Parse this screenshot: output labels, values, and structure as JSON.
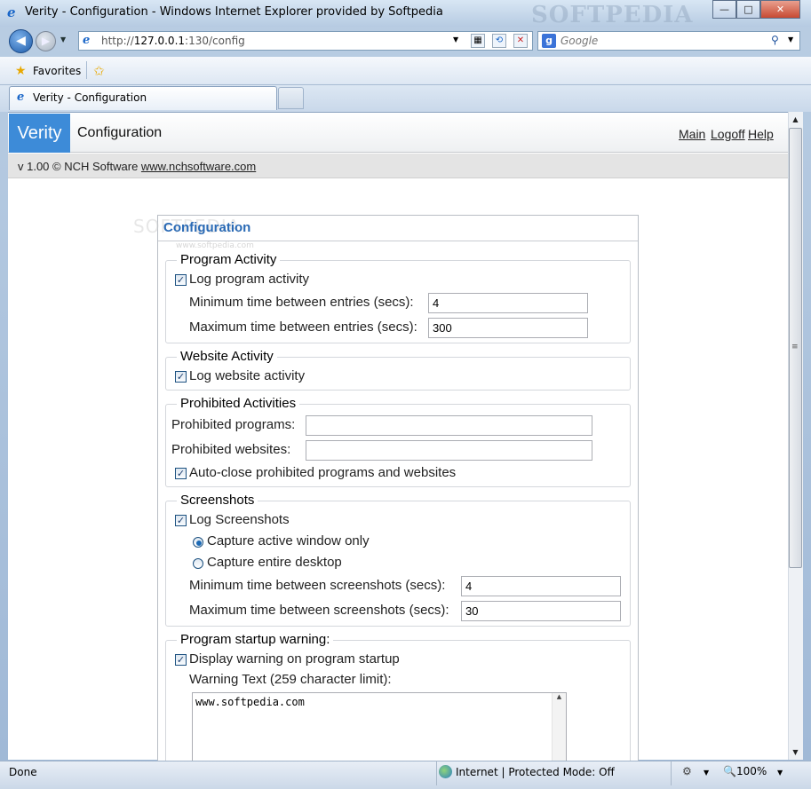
{
  "window": {
    "title": "Verity - Configuration - Windows Internet Explorer provided by Softpedia",
    "watermark": "SOFTPEDIA",
    "buttons": {
      "minimize": "—",
      "maximize": "□",
      "close": "✕"
    }
  },
  "nav": {
    "address_prefix": "http://",
    "address_host": "127.0.0.1",
    "address_rest": ":130/config",
    "search_placeholder": "Google"
  },
  "favorites": {
    "label": "Favorites"
  },
  "tabs": [
    {
      "label": "Verity - Configuration"
    }
  ],
  "app": {
    "logo": "Verity",
    "page": "Configuration",
    "links": [
      "Main",
      "Logoff",
      "Help"
    ],
    "version_text": "v 1.00 © NCH Software ",
    "version_link": "www.nchsoftware.com"
  },
  "panel": {
    "title": "Configuration",
    "watermark": "SOFTPEDIA",
    "watermark_url": "www.softpedia.com"
  },
  "program_activity": {
    "legend": "Program Activity",
    "log_label": "Log program activity",
    "log_checked": true,
    "min_label": "Minimum time between entries (secs):",
    "min_value": "4",
    "max_label": "Maximum time between entries (secs):",
    "max_value": "300"
  },
  "website_activity": {
    "legend": "Website Activity",
    "log_label": "Log website activity",
    "log_checked": true
  },
  "prohibited": {
    "legend": "Prohibited Activities",
    "programs_label": "Prohibited programs:",
    "programs_value": "",
    "websites_label": "Prohibited websites:",
    "websites_value": "",
    "autoclose_label": "Auto-close prohibited programs and websites",
    "autoclose_checked": true
  },
  "screenshots": {
    "legend": "Screenshots",
    "log_label": "Log Screenshots",
    "log_checked": true,
    "radio_active": "Capture active window only",
    "radio_desktop": "Capture entire desktop",
    "selected": "active",
    "min_label": "Minimum time between screenshots (secs):",
    "min_value": "4",
    "max_label": "Maximum time between screenshots (secs):",
    "max_value": "30"
  },
  "startup_warning": {
    "legend": "Program startup warning:",
    "display_label": "Display warning on program startup",
    "display_checked": true,
    "text_label": "Warning Text (259 character limit):",
    "text_value": "www.softpedia.com"
  },
  "status": {
    "left": "Done",
    "zone": "Internet | Protected Mode: Off",
    "zoom": "100%"
  }
}
